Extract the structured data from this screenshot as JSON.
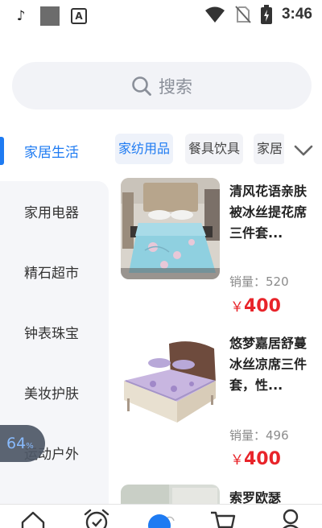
{
  "status_bar": {
    "time": "3:46",
    "icons": [
      "tiktok-icon",
      "gray-square-icon",
      "a-icon",
      "wifi-icon",
      "no-sim-icon",
      "battery-charging-icon"
    ]
  },
  "search": {
    "placeholder": "搜索",
    "icon": "search-icon"
  },
  "sidebar": {
    "items": [
      {
        "label": "家居生活",
        "active": true
      },
      {
        "label": "家用电器"
      },
      {
        "label": "精石超市"
      },
      {
        "label": "钟表珠宝"
      },
      {
        "label": "美妆护肤"
      },
      {
        "label": "运动户外"
      }
    ]
  },
  "subtabs": {
    "items": [
      "家纺用品",
      "餐具饮具",
      "家居"
    ],
    "active_index": 0,
    "expand_icon": "chevron-down-icon"
  },
  "products": [
    {
      "title": "清风花语亲肤被冰丝提花席三件套...",
      "sales_label": "销量：",
      "sales": "520",
      "currency": "￥",
      "price": "400"
    },
    {
      "title": "悠梦嘉居舒蔓冰丝凉席三件套，性...",
      "sales_label": "销量：",
      "sales": "496",
      "currency": "￥",
      "price": "400"
    },
    {
      "title": "索罗欧瑟"
    }
  ],
  "floating_badge": {
    "value": "64",
    "unit": "%"
  },
  "bottom_nav": {
    "icons": [
      "home-icon",
      "alarm-clock-icon",
      "category-icon",
      "cart-icon",
      "profile-icon"
    ]
  },
  "colors": {
    "accent": "#1e7bf2",
    "price": "#e8242a",
    "sidebar_bg": "#f5f6f9",
    "search_bg": "#f2f3f7"
  }
}
